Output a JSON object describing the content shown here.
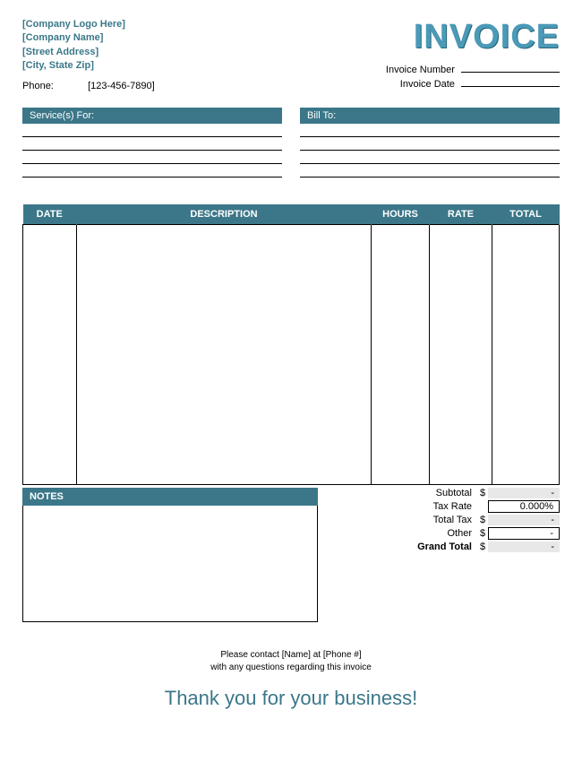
{
  "company": {
    "logo_placeholder": "[Company Logo Here]",
    "name_placeholder": "[Company Name]",
    "street_placeholder": "[Street Address]",
    "citystate_placeholder": "[City, State Zip]",
    "phone_label": "Phone:",
    "phone_value": "[123-456-7890]"
  },
  "title": "INVOICE",
  "meta": {
    "number_label": "Invoice Number",
    "date_label": "Invoice Date"
  },
  "sections": {
    "services_for": "Service(s) For:",
    "bill_to": "Bill To:"
  },
  "columns": {
    "date": "DATE",
    "description": "DESCRIPTION",
    "hours": "HOURS",
    "rate": "RATE",
    "total": "TOTAL"
  },
  "notes_header": "NOTES",
  "totals": {
    "subtotal_label": "Subtotal",
    "subtotal_value": "-",
    "taxrate_label": "Tax Rate",
    "taxrate_value": "0.000%",
    "totaltax_label": "Total Tax",
    "totaltax_value": "-",
    "other_label": "Other",
    "other_value": "-",
    "grand_label": "Grand Total",
    "grand_value": "-",
    "currency": "$"
  },
  "footer": {
    "line1": "Please contact [Name] at [Phone #]",
    "line2": "with any questions regarding this invoice",
    "thank_you": "Thank you for your business!"
  }
}
